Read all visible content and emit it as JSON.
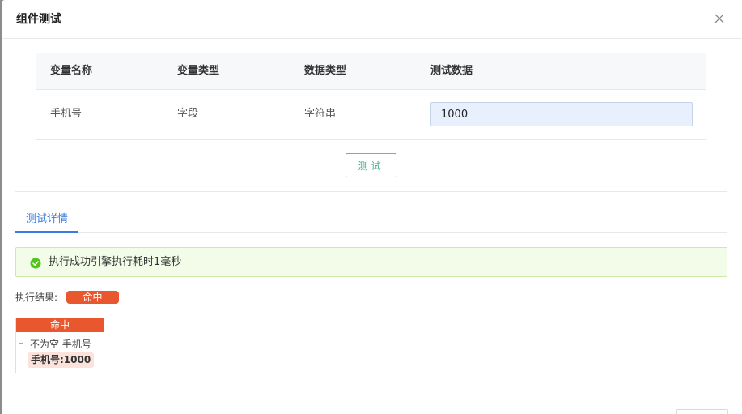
{
  "dialog": {
    "title": "组件测试"
  },
  "table": {
    "headers": [
      "变量名称",
      "变量类型",
      "数据类型",
      "测试数据"
    ],
    "rows": [
      {
        "name": "手机号",
        "var_type": "字段",
        "data_type": "字符串",
        "test_value": "1000"
      }
    ]
  },
  "test_button": {
    "label": "测试"
  },
  "tabs": [
    {
      "label": "测试详情",
      "active": true
    }
  ],
  "alert": {
    "message": "执行成功引擎执行耗时1毫秒",
    "status": "success"
  },
  "result": {
    "label": "执行结果:",
    "badge": "命中"
  },
  "tree": {
    "root": "命中",
    "condition": "不为空 手机号",
    "leaf": "手机号:1000"
  },
  "colors": {
    "accent_blue": "#3a7de0",
    "success_green": "#52c41a",
    "hit_red": "#e9572f",
    "test_button": "#3aa98a"
  },
  "icons": {
    "close": "close-icon",
    "alert": "check-circle-icon"
  }
}
